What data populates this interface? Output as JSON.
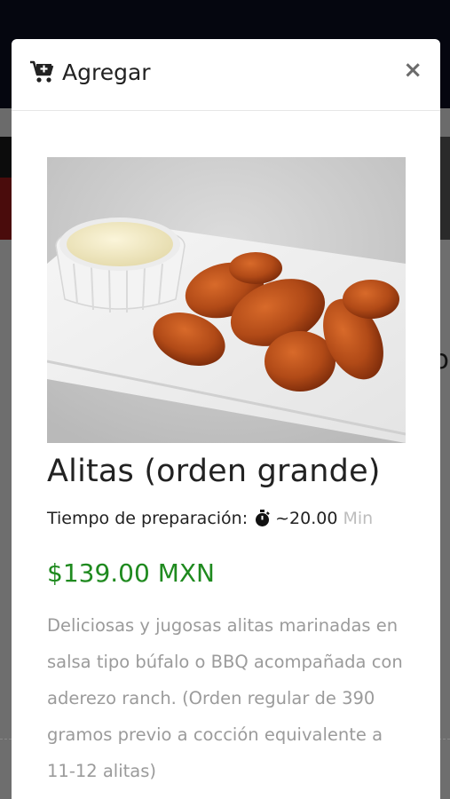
{
  "modal": {
    "title": "Agregar",
    "close_symbol": "×",
    "icons": {
      "title_icon": "cart-plus-icon",
      "close_icon": "close-icon",
      "timer_icon": "stopwatch-icon"
    }
  },
  "product": {
    "name": "Alitas (orden grande)",
    "prep_label": "Tiempo de preparación:",
    "prep_time": "~20.00",
    "prep_unit": "Min",
    "price": "$139.00 MXN",
    "description": "Deliciosas y jugosas alitas marinadas en salsa tipo búfalo o BBQ acompañada con aderezo ranch. (Orden regular de 390 gramos previo a cocción equivalente a 11-12 alitas)"
  },
  "background": {
    "partial_letter": "o"
  },
  "colors": {
    "price": "#1f8a1f",
    "description": "#9b9b9b",
    "overlay_top": "#05060f"
  }
}
